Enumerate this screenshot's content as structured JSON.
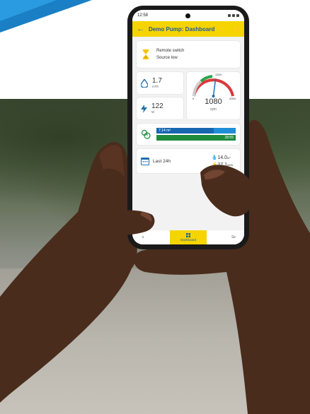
{
  "status_bar": {
    "time": "12:58"
  },
  "app_bar": {
    "title": "Demo Pump: Dashboard"
  },
  "status_card": {
    "line1": "Remote switch",
    "line2": "Source low"
  },
  "flow": {
    "value": "1.7",
    "unit": "m³/h"
  },
  "power": {
    "value": "122",
    "unit": "W"
  },
  "gauge": {
    "value": "1080",
    "unit": "rpm",
    "min_label": "0",
    "max_label": "2000",
    "mark_label": "1320",
    "needle_fraction": 0.54
  },
  "volume_bar": {
    "label": "7.14 m³",
    "fill_fraction": 0.72
  },
  "time_bar": {
    "label": "28:55"
  },
  "last_card": {
    "label": "Last 24h",
    "water": "14.0",
    "water_unit": "m³",
    "energy": "27.1",
    "energy_unit": "kWh"
  },
  "nav": {
    "left": "s",
    "active": "Dashboard",
    "right": "Se"
  },
  "colors": {
    "accent_yellow": "#f5d400",
    "brand_blue": "#1f5aa0",
    "bar_blue": "#1f8ed6",
    "bar_green": "#1e8a3c",
    "gauge_red": "#d93a3a"
  },
  "icons": {
    "back": "arrow-left-icon",
    "plug": "plug-icon",
    "hourglass": "hourglass-icon",
    "drop": "water-drop-icon",
    "bolt": "lightning-icon",
    "timer": "timer-icon",
    "calendar": "calendar-icon",
    "dashboard": "grid-icon"
  }
}
